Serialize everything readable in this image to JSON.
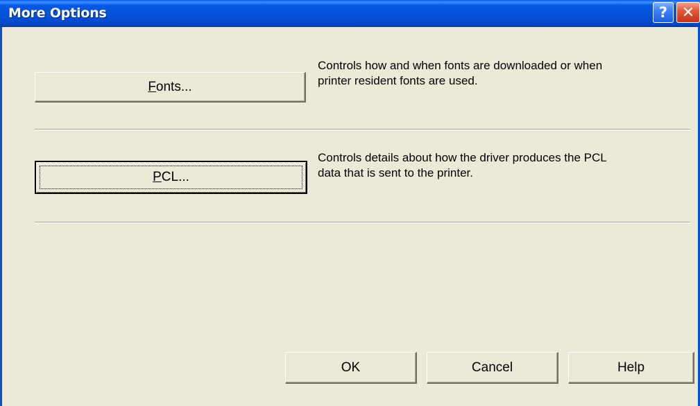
{
  "window": {
    "title": "More Options",
    "help_icon": "question-mark-icon",
    "help_glyph": "?",
    "close_icon": "close-x-icon",
    "close_glyph": "✕"
  },
  "options": [
    {
      "button_prefix": "",
      "button_mnemonic": "F",
      "button_rest": "onts...",
      "description_line1": "Controls how and when fonts are downloaded or when",
      "description_line2": "printer resident fonts are used."
    },
    {
      "button_prefix": "",
      "button_mnemonic": "P",
      "button_rest": "CL...",
      "description_line1": "Controls details about how the driver produces the PCL",
      "description_line2": "data that is sent to the printer."
    }
  ],
  "footer": {
    "ok_label": "OK",
    "cancel_label": "Cancel",
    "help_label": "Help"
  }
}
